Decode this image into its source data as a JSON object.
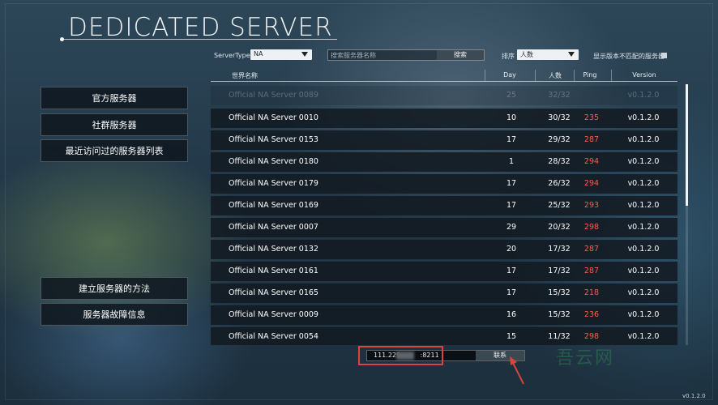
{
  "title": "DEDICATED SERVER",
  "filters": {
    "server_type_label": "ServerType",
    "server_type_value": "NA",
    "search_placeholder": "搜索服务器名称",
    "search_button": "搜索",
    "sort_label": "排序",
    "sort_value": "人数",
    "mismatch_label": "显示版本不匹配的服务器"
  },
  "columns": {
    "name": "世界名称",
    "day": "Day",
    "players": "人数",
    "ping": "Ping",
    "version": "Version"
  },
  "servers": [
    {
      "name": "Official NA Server 0089",
      "day": "25",
      "players": "32/32",
      "ping": "",
      "version": "v0.1.2.0"
    },
    {
      "name": "Official NA Server 0010",
      "day": "10",
      "players": "30/32",
      "ping": "235",
      "version": "v0.1.2.0"
    },
    {
      "name": "Official NA Server 0153",
      "day": "17",
      "players": "29/32",
      "ping": "287",
      "version": "v0.1.2.0"
    },
    {
      "name": "Official NA Server 0180",
      "day": "1",
      "players": "28/32",
      "ping": "294",
      "version": "v0.1.2.0"
    },
    {
      "name": "Official NA Server 0179",
      "day": "17",
      "players": "26/32",
      "ping": "294",
      "version": "v0.1.2.0"
    },
    {
      "name": "Official NA Server 0169",
      "day": "17",
      "players": "25/32",
      "ping": "293",
      "version": "v0.1.2.0"
    },
    {
      "name": "Official NA Server 0007",
      "day": "29",
      "players": "20/32",
      "ping": "298",
      "version": "v0.1.2.0"
    },
    {
      "name": "Official NA Server 0132",
      "day": "20",
      "players": "17/32",
      "ping": "287",
      "version": "v0.1.2.0"
    },
    {
      "name": "Official NA Server 0161",
      "day": "17",
      "players": "17/32",
      "ping": "287",
      "version": "v0.1.2.0"
    },
    {
      "name": "Official NA Server 0165",
      "day": "17",
      "players": "15/32",
      "ping": "218",
      "version": "v0.1.2.0"
    },
    {
      "name": "Official NA Server 0009",
      "day": "16",
      "players": "15/32",
      "ping": "236",
      "version": "v0.1.2.0"
    },
    {
      "name": "Official NA Server 0054",
      "day": "15",
      "players": "11/32",
      "ping": "298",
      "version": "v0.1.2.0"
    }
  ],
  "menu": {
    "official": "官方服务器",
    "community": "社群服务器",
    "recent": "最近访问过的服务器列表",
    "howto": "建立服务器的方法",
    "troubleshoot": "服务器故障信息"
  },
  "connect": {
    "ip_prefix": "111.229.",
    "ip_suffix": ":8211",
    "button": "联系"
  },
  "watermark": "吾云网",
  "corner_version": "v0.1.2.0",
  "colors": {
    "ping": "#ff5a4e",
    "highlight": "#d9453a"
  }
}
